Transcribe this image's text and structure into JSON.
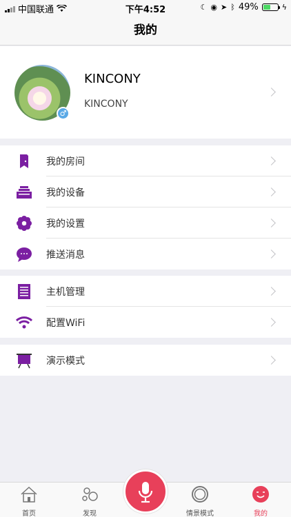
{
  "status_bar": {
    "carrier": "中国联通",
    "time": "下午4:52",
    "battery": "49%",
    "battery_level": 0.49
  },
  "nav": {
    "title": "我的"
  },
  "profile": {
    "name": "KINCONY",
    "subtitle": "KINCONY",
    "gender_symbol": "♂"
  },
  "menu_groups": [
    [
      {
        "label": "我的房间",
        "icon": "room-icon"
      },
      {
        "label": "我的设备",
        "icon": "device-icon"
      },
      {
        "label": "我的设置",
        "icon": "settings-gear-icon"
      },
      {
        "label": "推送消息",
        "icon": "message-bubble-icon"
      }
    ],
    [
      {
        "label": "主机管理",
        "icon": "host-icon"
      },
      {
        "label": "配置WiFi",
        "icon": "wifi-icon"
      }
    ],
    [
      {
        "label": "演示模式",
        "icon": "presentation-icon"
      }
    ]
  ],
  "tabs": [
    {
      "label": "首页",
      "icon": "home-icon"
    },
    {
      "label": "发现",
      "icon": "discover-icon"
    },
    {
      "label": "情景模式",
      "icon": "scene-icon"
    },
    {
      "label": "我的",
      "icon": "smiley-icon"
    }
  ],
  "colors": {
    "accent": "#e8405a",
    "icon_purple": "#7b1fa2",
    "background": "#efeff4"
  }
}
